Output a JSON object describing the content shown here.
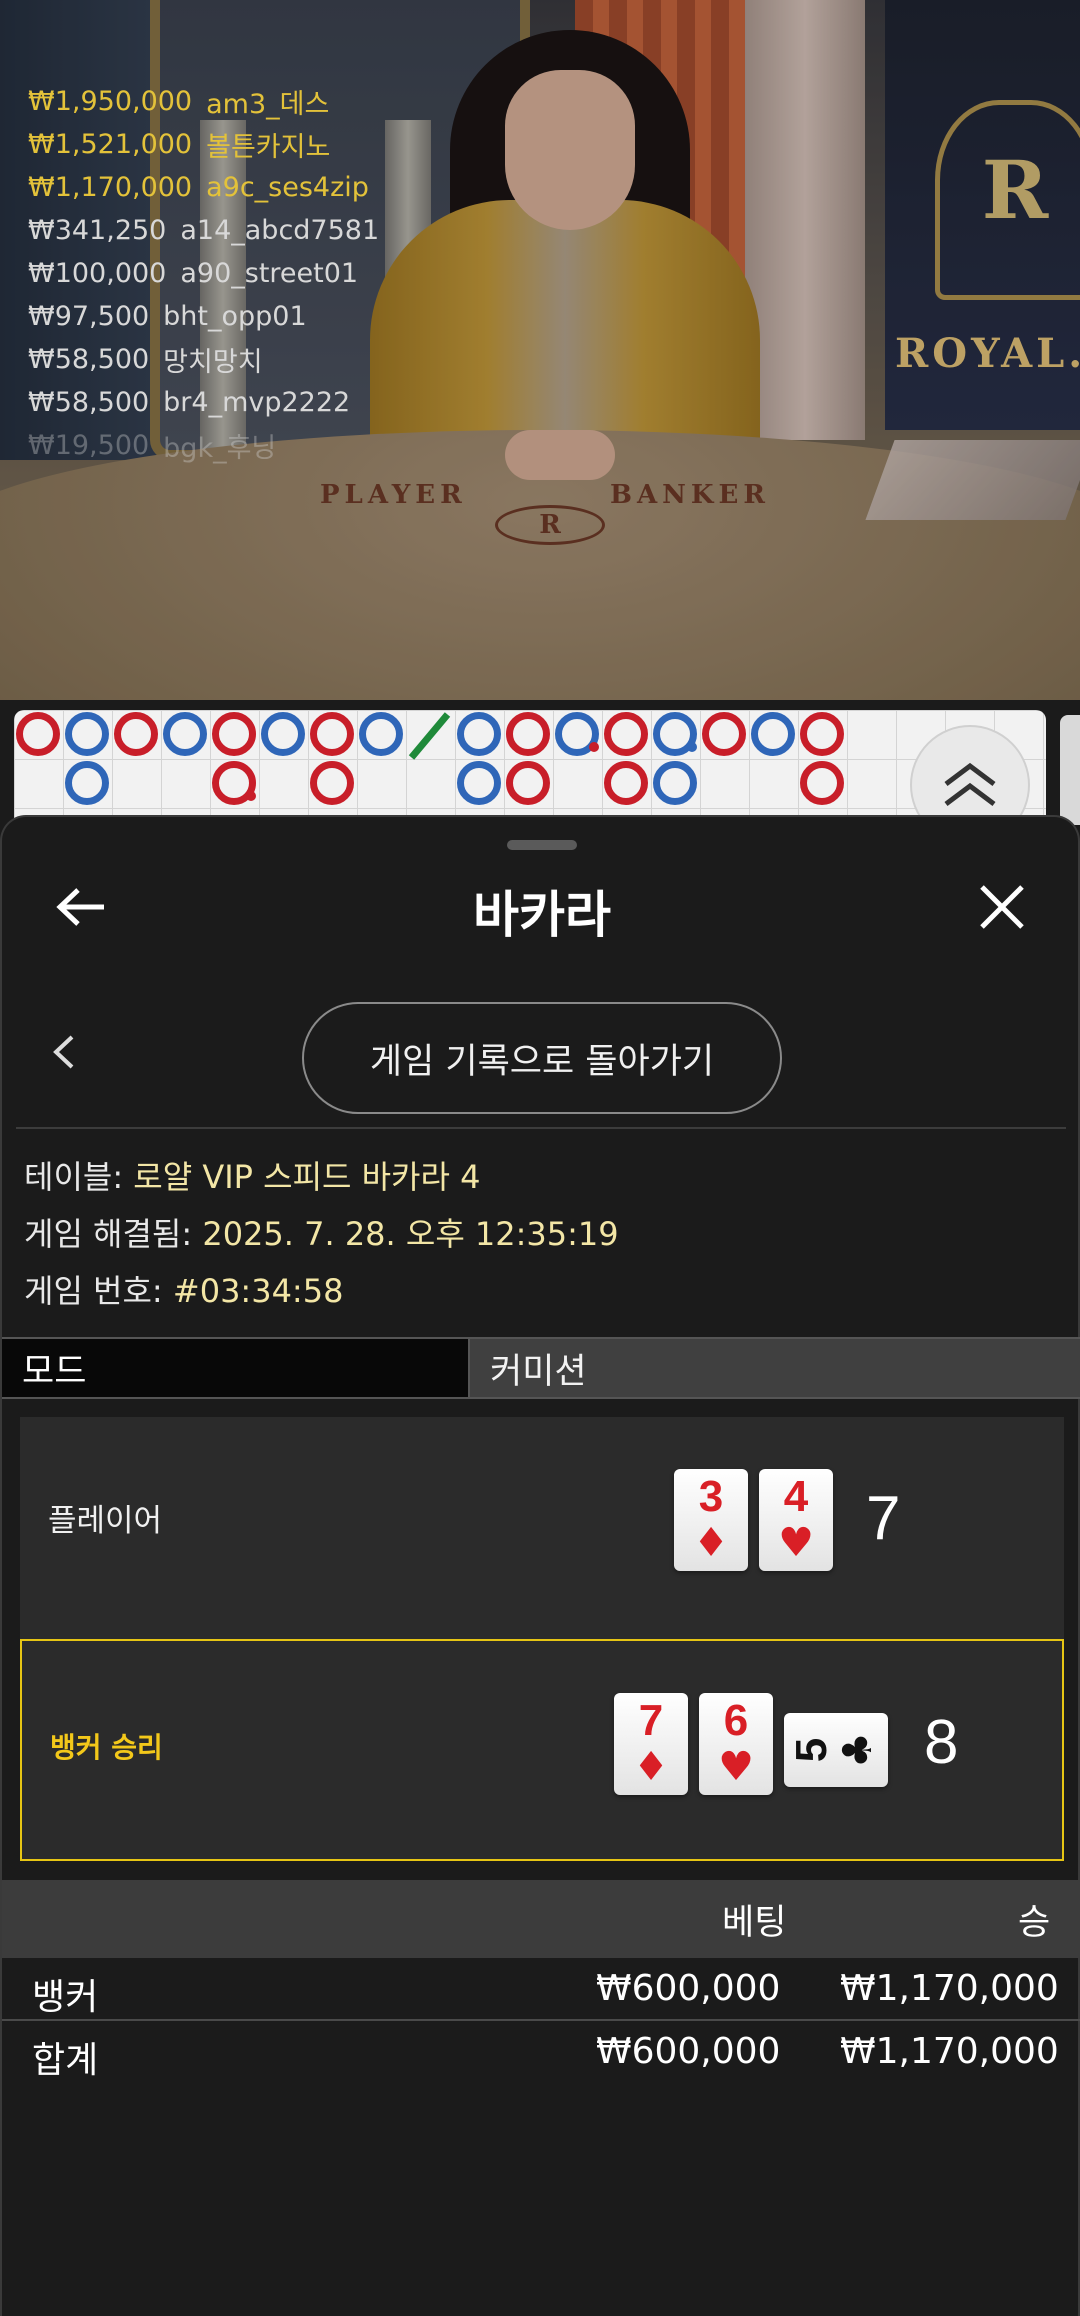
{
  "stream": {
    "winners": [
      {
        "amount": "₩1,950,000",
        "user": "am3_데스",
        "highlight": true
      },
      {
        "amount": "₩1,521,000",
        "user": "볼튼카지노",
        "highlight": true
      },
      {
        "amount": "₩1,170,000",
        "user": "a9c_ses4zip",
        "highlight": true
      },
      {
        "amount": "₩341,250",
        "user": "a14_abcd7581",
        "highlight": false
      },
      {
        "amount": "₩100,000",
        "user": "a90_street01",
        "highlight": false
      },
      {
        "amount": "₩97,500",
        "user": "bht_opp01",
        "highlight": false
      },
      {
        "amount": "₩58,500",
        "user": "망치망치",
        "highlight": false
      },
      {
        "amount": "₩58,500",
        "user": "br4_mvp2222",
        "highlight": false
      },
      {
        "amount": "₩19,500",
        "user": "bgk_후닝",
        "highlight": false
      }
    ],
    "table_text": {
      "player": "PLAYER",
      "banker": "BANKER",
      "logo": "R",
      "brand": "ROYAL.I"
    },
    "roadmap": {
      "row1": [
        "b",
        "p",
        "b",
        "p",
        "b",
        "p",
        "b",
        "p",
        "tie",
        "p",
        "b",
        "p",
        "b",
        "p",
        "b",
        "p",
        "b"
      ],
      "row2": [
        "",
        "p",
        "",
        "",
        "b",
        "",
        "b",
        "",
        "",
        "p",
        "b",
        "",
        "b",
        "p",
        "",
        "",
        "b"
      ]
    }
  },
  "sheet": {
    "title": "바카라",
    "icons": {
      "back": "arrow-left-icon",
      "close": "close-icon",
      "prev": "chevron-left-icon",
      "toggle": "chevron-up-double-icon"
    },
    "history_button": "게임 기록으로 돌아가기",
    "info": {
      "table_label": "테이블: ",
      "table_value": "로얄 VIP 스피드 바카라 4",
      "resolved_label": "게임 해결됨: ",
      "resolved_value": "2025. 7. 28. 오후 12:35:19",
      "number_label": "게임 번호: ",
      "number_value": "#03:34:58"
    },
    "tabs": [
      {
        "label": "모드",
        "active": true
      },
      {
        "label": "커미션",
        "active": false
      }
    ],
    "player": {
      "label": "플레이어",
      "cards": [
        {
          "rank": "3",
          "suit": "♦"
        },
        {
          "rank": "4",
          "suit": "♥"
        }
      ],
      "score": "7"
    },
    "banker": {
      "label": "뱅커 승리",
      "cards": [
        {
          "rank": "7",
          "suit": "♦"
        },
        {
          "rank": "6",
          "suit": "♥"
        }
      ],
      "third_card": {
        "rank": "5",
        "suit": "♣"
      },
      "score": "8"
    },
    "summary": {
      "headers": {
        "bet": "베팅",
        "win": "승"
      },
      "rows": [
        {
          "label": "뱅커",
          "bet": "₩600,000",
          "win": "₩1,170,000"
        },
        {
          "label": "합계",
          "bet": "₩600,000",
          "win": "₩1,170,000"
        }
      ]
    },
    "colors": {
      "accent": "#e6c514",
      "banker_red": "#c81e29",
      "player_blue": "#2f66b8"
    }
  }
}
